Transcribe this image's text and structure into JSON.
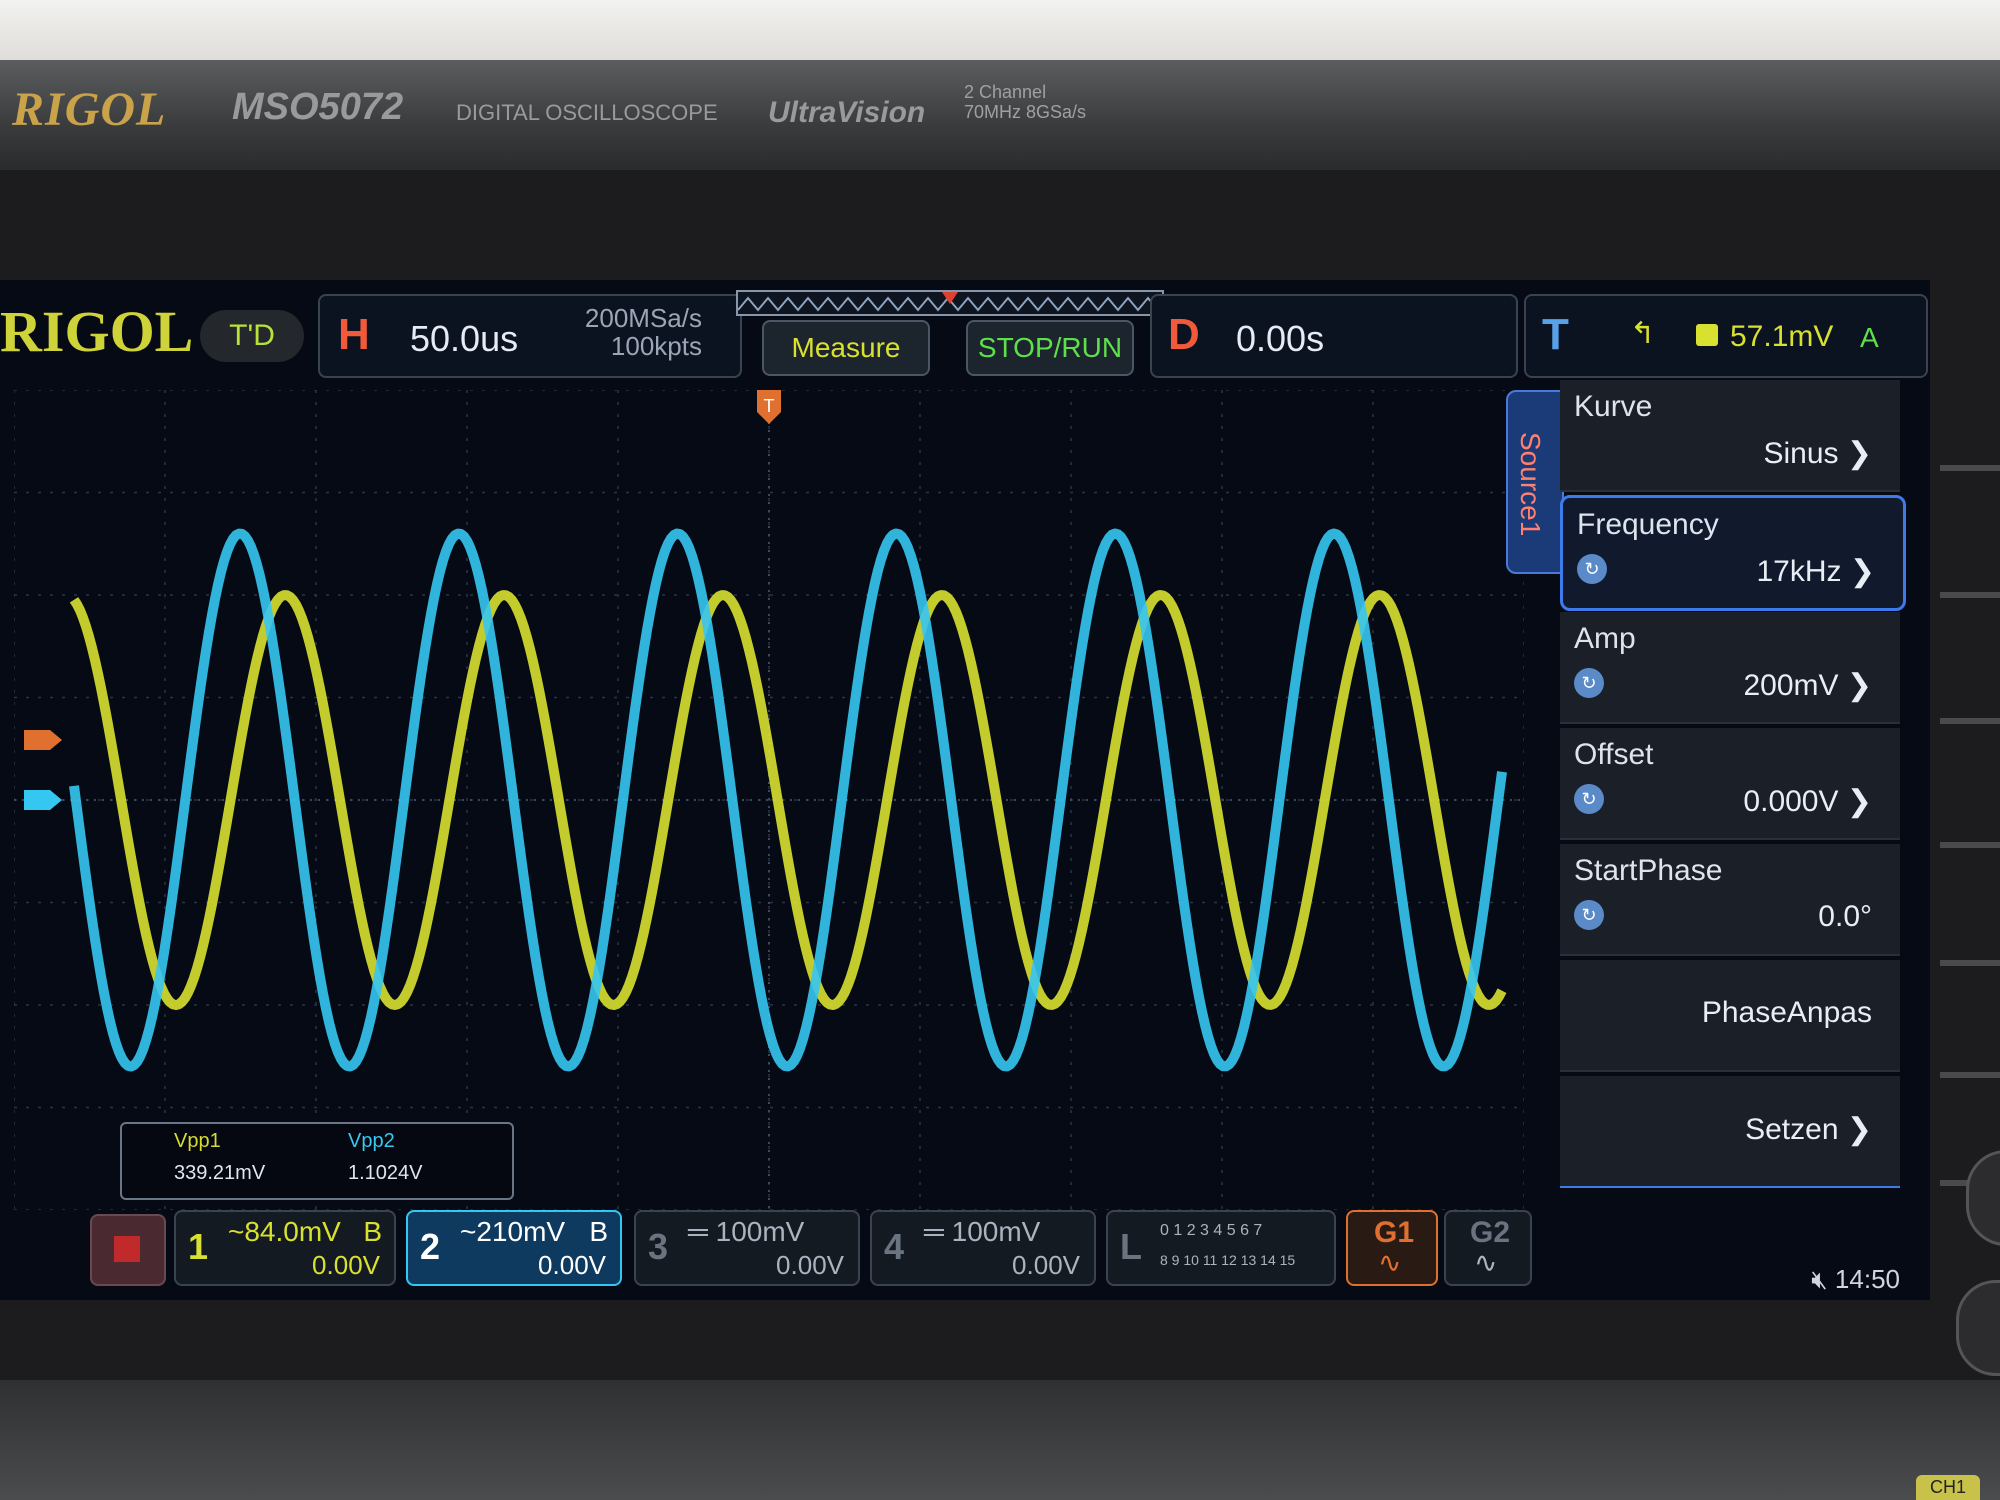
{
  "device": {
    "brand": "RIGOL",
    "model": "MSO5072",
    "description": "DIGITAL OSCILLOSCOPE",
    "technology": "UltraVision",
    "channels_spec": "2 Channel",
    "bandwidth_spec": "70MHz 8GSa/s",
    "corner_tag": "CH1"
  },
  "status": {
    "logo": "RIGOL",
    "trigger_state": "T'D"
  },
  "horizontal": {
    "label": "H",
    "timebase": "50.0us",
    "sample_rate": "200MSa/s",
    "memory_depth": "100kpts"
  },
  "toolbar": {
    "measure_label": "Measure",
    "stop_run_label": "STOP/RUN"
  },
  "delay": {
    "label": "D",
    "value": "0.00s"
  },
  "trigger": {
    "label": "T",
    "level": "57.1mV",
    "mode": "A",
    "marker": "T"
  },
  "source_menu": {
    "tab_label": "Source1",
    "items": [
      {
        "label": "Kurve",
        "value": "Sinus"
      },
      {
        "label": "Frequency",
        "value": "17kHz"
      },
      {
        "label": "Amp",
        "value": "200mV"
      },
      {
        "label": "Offset",
        "value": "0.000V"
      },
      {
        "label": "StartPhase",
        "value": "0.0°"
      },
      {
        "label": "PhaseAnpas",
        "value": ""
      },
      {
        "label": "Setzen",
        "value": ""
      }
    ]
  },
  "measurements": [
    {
      "name": "Vpp1",
      "value": "339.21mV",
      "color": "#d8dc30"
    },
    {
      "name": "Vpp2",
      "value": "1.1024V",
      "color": "#38c8f0"
    }
  ],
  "channels": [
    {
      "num": "1",
      "scale": "~84.0mV",
      "coupling": "B",
      "offset": "0.00V",
      "color": "#d8e030",
      "active": false
    },
    {
      "num": "2",
      "scale": "~210mV",
      "coupling": "B",
      "offset": "0.00V",
      "color": "#36c6f2",
      "active": true
    },
    {
      "num": "3",
      "scale": "═ 100mV",
      "coupling": "",
      "offset": "0.00V",
      "color": "#6a7480",
      "active": false
    },
    {
      "num": "4",
      "scale": "═ 100mV",
      "coupling": "",
      "offset": "0.00V",
      "color": "#6a7480",
      "active": false
    }
  ],
  "logic": {
    "label": "L",
    "row1": "0 1 2 3  4 5 6 7",
    "row2": "8 9 10 11 12 13 14 15"
  },
  "generators": [
    {
      "label": "G1",
      "color": "#e07030"
    },
    {
      "label": "G2",
      "color": "#6a7480"
    }
  ],
  "clock": "14:50",
  "waveforms": {
    "cycles_visible": 6.9,
    "ch1": {
      "color": "#d8e030",
      "amplitude_div": 2.0,
      "phase_lag_div": 0.3
    },
    "ch2": {
      "color": "#36c6f2",
      "amplitude_div": 2.6,
      "phase_lag_div": 0.0
    }
  },
  "colors": {
    "ch1": "#d8e030",
    "ch2": "#36c6f2",
    "accent": "#3f7aea",
    "alert": "#e04030"
  }
}
